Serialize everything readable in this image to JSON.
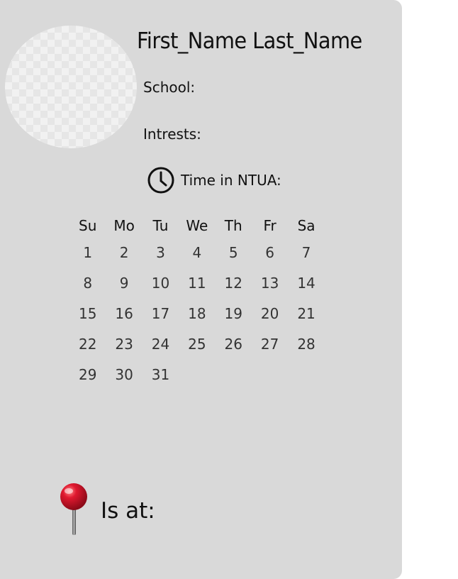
{
  "profile": {
    "name": "First_Name Last_Name",
    "school_label": "School:",
    "interests_label": "Intrests:",
    "time_label": "Time in NTUA:"
  },
  "calendar": {
    "weekdays": [
      "Su",
      "Mo",
      "Tu",
      "We",
      "Th",
      "Fr",
      "Sa"
    ],
    "weeks": [
      [
        "1",
        "2",
        "3",
        "4",
        "5",
        "6",
        "7"
      ],
      [
        "8",
        "9",
        "10",
        "11",
        "12",
        "13",
        "14"
      ],
      [
        "15",
        "16",
        "17",
        "18",
        "19",
        "20",
        "21"
      ],
      [
        "22",
        "23",
        "24",
        "25",
        "26",
        "27",
        "28"
      ],
      [
        "29",
        "30",
        "31",
        "",
        "",
        "",
        ""
      ]
    ]
  },
  "location": {
    "label": "Is at:",
    "icon": "pushpin-icon"
  },
  "icons": {
    "clock": "clock-icon"
  },
  "colors": {
    "card_background": "#d9d9d9",
    "pin_red": "#c8102e"
  }
}
